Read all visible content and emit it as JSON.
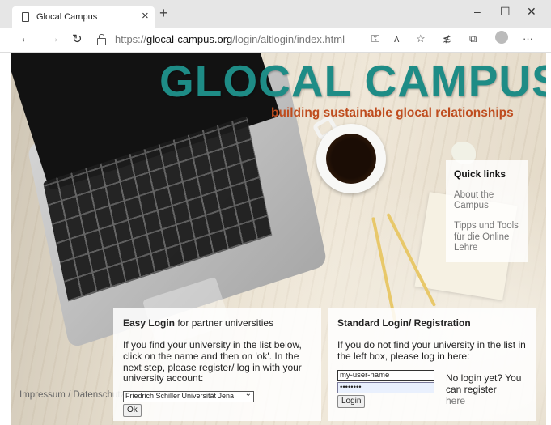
{
  "browser": {
    "tab_title": "Glocal Campus",
    "tab_close": "×",
    "new_tab": "+",
    "window_min": "–",
    "window_max": "☐",
    "window_close": "✕",
    "url_prefix": "https://",
    "url_host": "glocal-campus.org",
    "url_path": "/login/altlogin/index.html",
    "icons": [
      "back-icon",
      "forward-icon",
      "refresh-icon",
      "lock-icon",
      "key-icon",
      "read-aloud-icon",
      "favorite-star-icon",
      "favorites-icon",
      "collections-icon",
      "profile-icon",
      "more-icon"
    ]
  },
  "site": {
    "title": "GLOCAL CAMPUS",
    "tagline": "building sustainable glocal relationships",
    "title_color": "#1e8c86",
    "tagline_color": "#bf4d1f"
  },
  "quick_links": {
    "heading": "Quick links",
    "items": [
      {
        "label": "About the Campus"
      },
      {
        "label": "Tipps und Tools für die Online Lehre"
      }
    ]
  },
  "easy_login": {
    "heading_bold": "Easy Login",
    "heading_rest": " for partner universities",
    "instructions": "If you find your university in the list below, click on the name and then on 'ok'. In the next step, please register/ log in with your university account:",
    "selected_university": "Friedrich Schiller Universität Jena",
    "ok_label": "Ok"
  },
  "standard_login": {
    "heading": "Standard Login/ Registration",
    "instructions": "If you do not find your university in the list in the left box, please log in here:",
    "username_value": "my-user-name",
    "password_value": "••••••••",
    "login_label": "Login",
    "no_login_text": "No login yet? You can register",
    "register_link": "here"
  },
  "footer": {
    "imprint_label": "Impressum / Datenschutz"
  }
}
